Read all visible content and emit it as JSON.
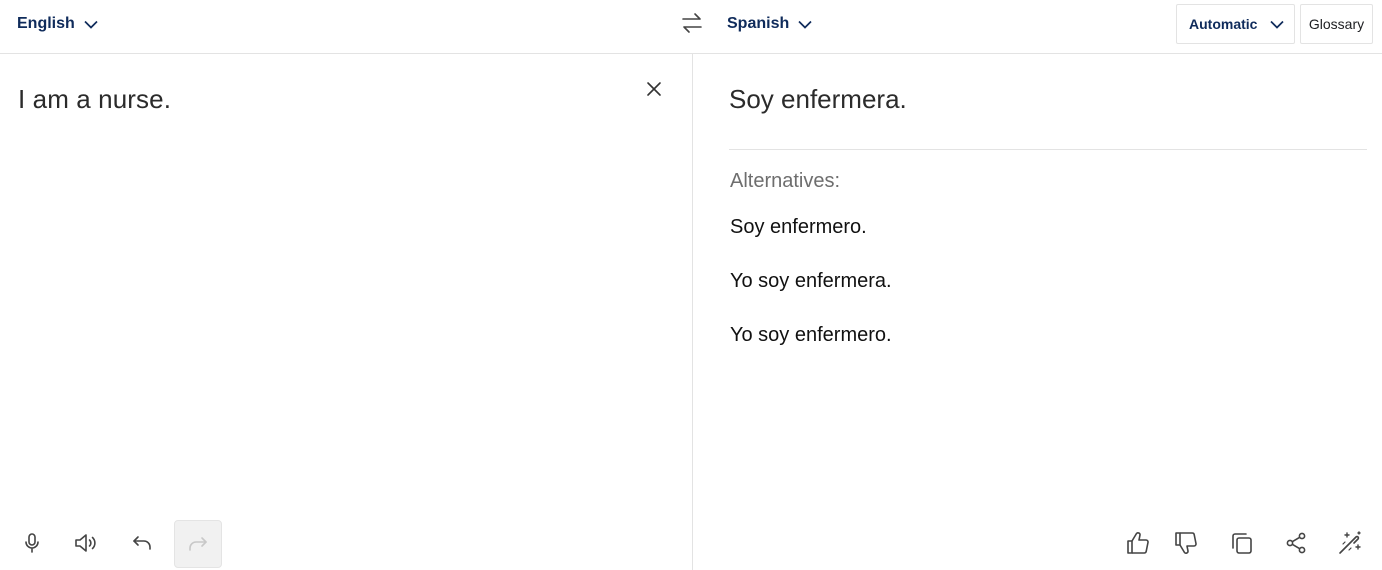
{
  "header": {
    "source_language": "English",
    "target_language": "Spanish",
    "formality": "Automatic",
    "glossary_label": "Glossary"
  },
  "source_panel": {
    "text": "I am a nurse."
  },
  "target_panel": {
    "translation": "Soy enfermera.",
    "alternatives_heading": "Alternatives:",
    "alternatives": [
      "Soy enfermero.",
      "Yo soy enfermera.",
      "Yo soy enfermero."
    ]
  },
  "icons": {
    "source_toolbar": [
      "microphone-icon",
      "speaker-icon",
      "undo-icon",
      "redo-icon"
    ],
    "target_toolbar": [
      "thumbs-up-icon",
      "thumbs-down-icon",
      "copy-icon",
      "share-icon",
      "magic-wand-icon"
    ]
  },
  "colors": {
    "accent": "#0f2b5b",
    "text": "#2b2b2b",
    "muted": "#6e6e6e",
    "border": "#e3e3e3",
    "disabled_bg": "#f1f1f1"
  }
}
